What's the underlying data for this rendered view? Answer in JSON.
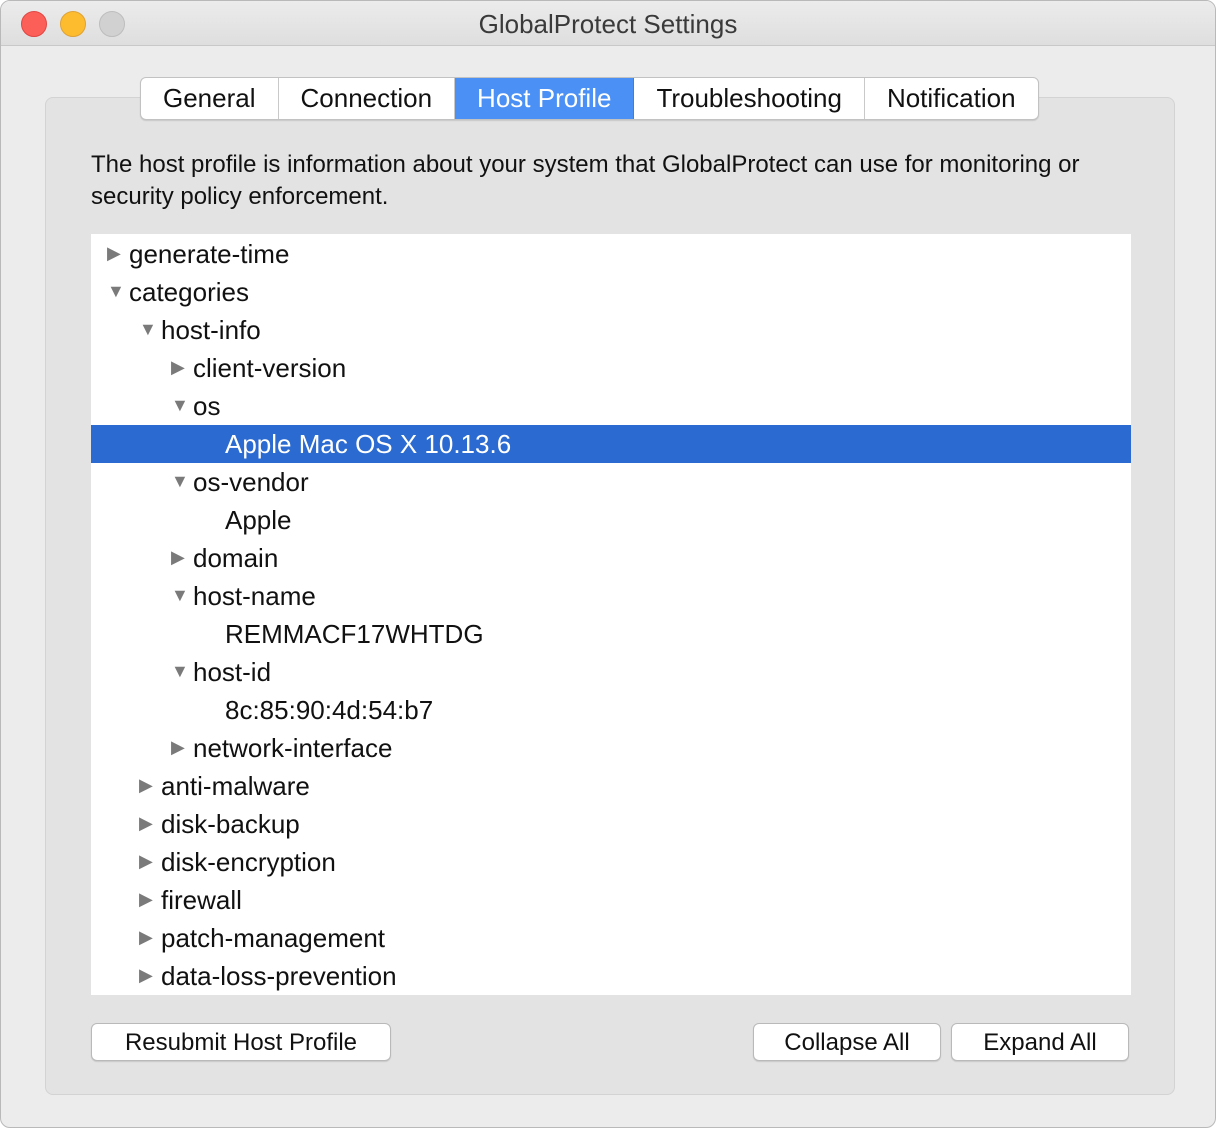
{
  "window": {
    "title": "GlobalProtect Settings"
  },
  "tabs": [
    {
      "label": "General"
    },
    {
      "label": "Connection"
    },
    {
      "label": "Host Profile",
      "active": true
    },
    {
      "label": "Troubleshooting"
    },
    {
      "label": "Notification"
    }
  ],
  "description": "The host profile is information about your system that GlobalProtect can use for monitoring or security policy enforcement.",
  "tree": [
    {
      "label": "generate-time",
      "depth": 0,
      "state": "collapsed"
    },
    {
      "label": "categories",
      "depth": 0,
      "state": "expanded"
    },
    {
      "label": "host-info",
      "depth": 1,
      "state": "expanded"
    },
    {
      "label": "client-version",
      "depth": 2,
      "state": "collapsed"
    },
    {
      "label": "os",
      "depth": 2,
      "state": "expanded"
    },
    {
      "label": "Apple Mac OS X 10.13.6",
      "depth": 3,
      "state": "leaf",
      "selected": true
    },
    {
      "label": "os-vendor",
      "depth": 2,
      "state": "expanded"
    },
    {
      "label": "Apple",
      "depth": 3,
      "state": "leaf"
    },
    {
      "label": "domain",
      "depth": 2,
      "state": "collapsed"
    },
    {
      "label": "host-name",
      "depth": 2,
      "state": "expanded"
    },
    {
      "label": "REMMACF17WHTDG",
      "depth": 3,
      "state": "leaf"
    },
    {
      "label": "host-id",
      "depth": 2,
      "state": "expanded"
    },
    {
      "label": "8c:85:90:4d:54:b7",
      "depth": 3,
      "state": "leaf"
    },
    {
      "label": "network-interface",
      "depth": 2,
      "state": "collapsed"
    },
    {
      "label": "anti-malware",
      "depth": 1,
      "state": "collapsed"
    },
    {
      "label": "disk-backup",
      "depth": 1,
      "state": "collapsed"
    },
    {
      "label": "disk-encryption",
      "depth": 1,
      "state": "collapsed"
    },
    {
      "label": "firewall",
      "depth": 1,
      "state": "collapsed"
    },
    {
      "label": "patch-management",
      "depth": 1,
      "state": "collapsed"
    },
    {
      "label": "data-loss-prevention",
      "depth": 1,
      "state": "collapsed"
    }
  ],
  "buttons": {
    "resubmit": "Resubmit Host Profile",
    "collapse_all": "Collapse All",
    "expand_all": "Expand All"
  },
  "colors": {
    "selection": "#2b6ad0",
    "active_tab": "#4a90f5",
    "close": "#fc5f57",
    "minimize": "#fdbc2e",
    "zoom": "#d1d1d1"
  }
}
